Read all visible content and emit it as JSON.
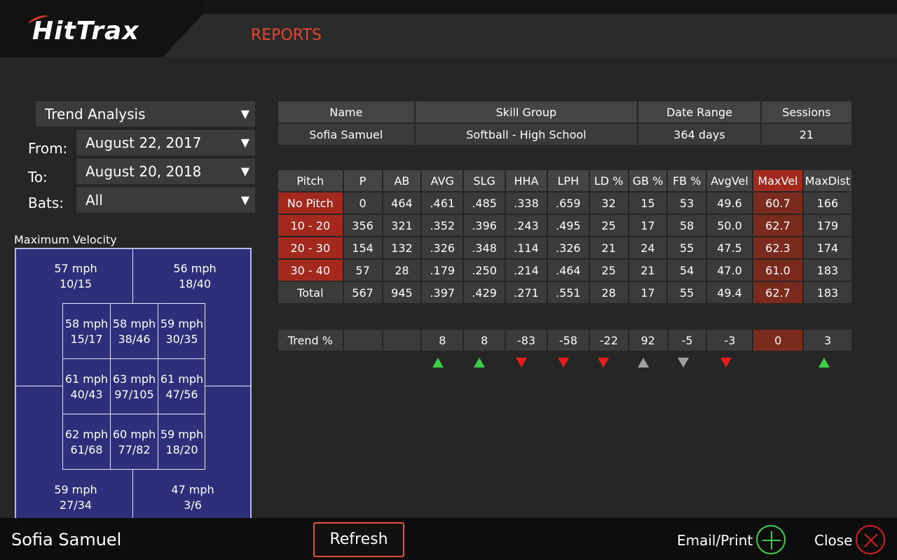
{
  "header": {
    "logo": "HitTrax",
    "section": "REPORTS"
  },
  "filters": {
    "report_type": "Trend Analysis",
    "from_label": "From:",
    "from_value": "August 22, 2017",
    "to_label": "To:",
    "to_value": "August 20, 2018",
    "bats_label": "Bats:",
    "bats_value": "All",
    "arrow": "▼"
  },
  "zone_chart": {
    "title": "Maximum Velocity",
    "outer": [
      {
        "mph": "57 mph",
        "ratio": "10/15"
      },
      {
        "mph": "56 mph",
        "ratio": "18/40"
      },
      {
        "mph": "59 mph",
        "ratio": "27/34"
      },
      {
        "mph": "47 mph",
        "ratio": "3/6"
      }
    ],
    "inner": [
      {
        "mph": "58 mph",
        "ratio": "15/17"
      },
      {
        "mph": "58 mph",
        "ratio": "38/46"
      },
      {
        "mph": "59 mph",
        "ratio": "30/35"
      },
      {
        "mph": "61 mph",
        "ratio": "40/43"
      },
      {
        "mph": "63 mph",
        "ratio": "97/105"
      },
      {
        "mph": "61 mph",
        "ratio": "47/56"
      },
      {
        "mph": "62 mph",
        "ratio": "61/68"
      },
      {
        "mph": "60 mph",
        "ratio": "77/82"
      },
      {
        "mph": "59 mph",
        "ratio": "18/20"
      }
    ]
  },
  "info": {
    "headers": [
      "Name",
      "Skill Group",
      "Date Range",
      "Sessions"
    ],
    "values": [
      "Sofia Samuel",
      "Softball - High School",
      "364 days",
      "21"
    ]
  },
  "stats": {
    "headers": [
      "Pitch",
      "P",
      "AB",
      "AVG",
      "SLG",
      "HHA",
      "LPH",
      "LD %",
      "GB %",
      "FB %",
      "AvgVel",
      "MaxVel",
      "MaxDist"
    ],
    "rows": [
      [
        "No Pitch",
        "0",
        "464",
        ".461",
        ".485",
        ".338",
        ".659",
        "32",
        "15",
        "53",
        "49.6",
        "60.7",
        "166"
      ],
      [
        "10 - 20",
        "356",
        "321",
        ".352",
        ".396",
        ".243",
        ".495",
        "25",
        "17",
        "58",
        "50.0",
        "62.7",
        "179"
      ],
      [
        "20 - 30",
        "154",
        "132",
        ".326",
        ".348",
        ".114",
        ".326",
        "21",
        "24",
        "55",
        "47.5",
        "62.3",
        "174"
      ],
      [
        "30 - 40",
        "57",
        "28",
        ".179",
        ".250",
        ".214",
        ".464",
        "25",
        "21",
        "54",
        "47.0",
        "61.0",
        "183"
      ],
      [
        "Total",
        "567",
        "945",
        ".397",
        ".429",
        ".271",
        ".551",
        "28",
        "17",
        "55",
        "49.4",
        "62.7",
        "183"
      ]
    ],
    "trend": [
      "Trend %",
      "",
      "",
      "8",
      "8",
      "-83",
      "-58",
      "-22",
      "92",
      "-5",
      "-3",
      "0",
      "3"
    ]
  },
  "trend_icons": [
    "",
    "",
    "",
    "up-green",
    "up-green",
    "down-red",
    "down-red",
    "down-red",
    "up-gray",
    "down-gray",
    "down-red",
    "",
    "up-green"
  ],
  "footer": {
    "player": "Sofia Samuel",
    "refresh": "Refresh",
    "email_print": "Email/Print",
    "close": "Close"
  }
}
